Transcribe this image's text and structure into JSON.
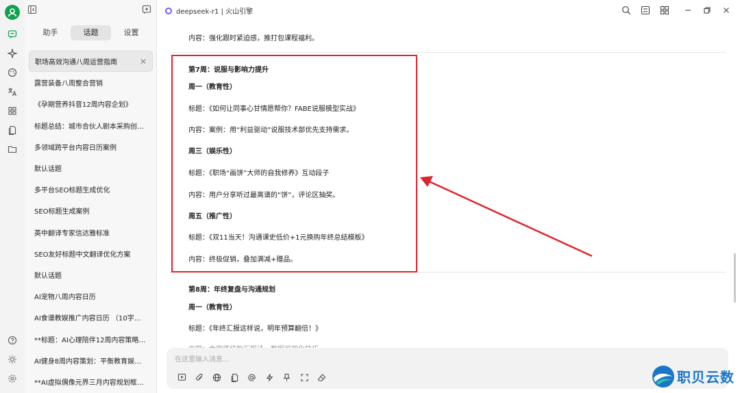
{
  "app": {
    "model_title": "deepseek-r1 | 火山引擎"
  },
  "sidebar": {
    "tabs": [
      {
        "label": "助手"
      },
      {
        "label": "话题"
      },
      {
        "label": "设置"
      }
    ],
    "conversations": [
      {
        "label": "职场高效沟通八周运营指南"
      },
      {
        "label": "露营装备八周整合营销"
      },
      {
        "label": "《孕期营养抖音12周内容企划》"
      },
      {
        "label": "标题总结：城市合伙人剧本采购创业..."
      },
      {
        "label": "多领域跨平台内容日历案例"
      },
      {
        "label": "默认话题"
      },
      {
        "label": "多平台SEO标题生成优化"
      },
      {
        "label": "SEO标题生成案例"
      },
      {
        "label": "英中翻译专家信达雅标准"
      },
      {
        "label": "SEO友好标题中文翻译优化方案"
      },
      {
        "label": "默认话题"
      },
      {
        "label": "AI宠物八周内容日历"
      },
      {
        "label": "AI食谱教娱推广内容日历 （10字，中..."
      },
      {
        "label": "**标题：AI心理陪伴12周内容策略规..."
      },
      {
        "label": "AI健身8周内容策划：平衡教育娱乐营销"
      },
      {
        "label": "**AI虚拟偶像元界三月内容规划框架*..."
      }
    ]
  },
  "content": {
    "intro_line": "内容：强化跟时紧迫感，推打包课程福利。",
    "week7": {
      "title": "第7周：说服与影响力提升",
      "mon_head": "周一（教育性）",
      "mon_title": "标题：《如何让同事心甘情愿帮你？FABE说服模型实战》",
      "mon_content": "内容：案例：用“利益驱动”说服技术部优先支持需求。",
      "wed_head": "周三（娱乐性）",
      "wed_title": "标题：《职场“画饼”大师的自我修养》互动段子",
      "wed_content": "内容：用户分享听过最离谱的“饼”，评论区抽奖。",
      "fri_head": "周五（推广性）",
      "fri_title": "标题：《双11当天！沟通课史低价+1元换购年终总结模板》",
      "fri_content": "内容：终极促销，叠加满减+赠品。"
    },
    "week8": {
      "title": "第8周：年终复盘与沟通规划",
      "mon_head": "周一（教育性）",
      "mon_title": "标题：《年终汇报这样说，明年预算翻倍！》",
      "mon_content_partial": "内容：金字塔结构汇报法，数据可视化技巧"
    }
  },
  "input": {
    "placeholder": "在这里输入消息..."
  },
  "watermark": {
    "text": "职贝云数"
  },
  "colors": {
    "annotation_red": "#e0242c",
    "brand_green": "#12a150",
    "watermark_blue": "#1b76c7"
  },
  "icons": {
    "rail": [
      "chat-icon",
      "sparkle-icon",
      "palette-icon",
      "translate-icon",
      "apps-icon",
      "files-icon",
      "folder-icon",
      "help-icon",
      "brightness-icon",
      "settings-icon"
    ],
    "topbar": [
      "search-icon",
      "layout-icon",
      "grid-icon",
      "minimize-icon",
      "restore-icon",
      "close-icon"
    ],
    "tools": [
      "new-topic-icon",
      "attach-icon",
      "web-icon",
      "knowledge-icon",
      "mention-icon",
      "flash-icon",
      "pin-icon",
      "expand-icon",
      "clear-icon"
    ]
  }
}
